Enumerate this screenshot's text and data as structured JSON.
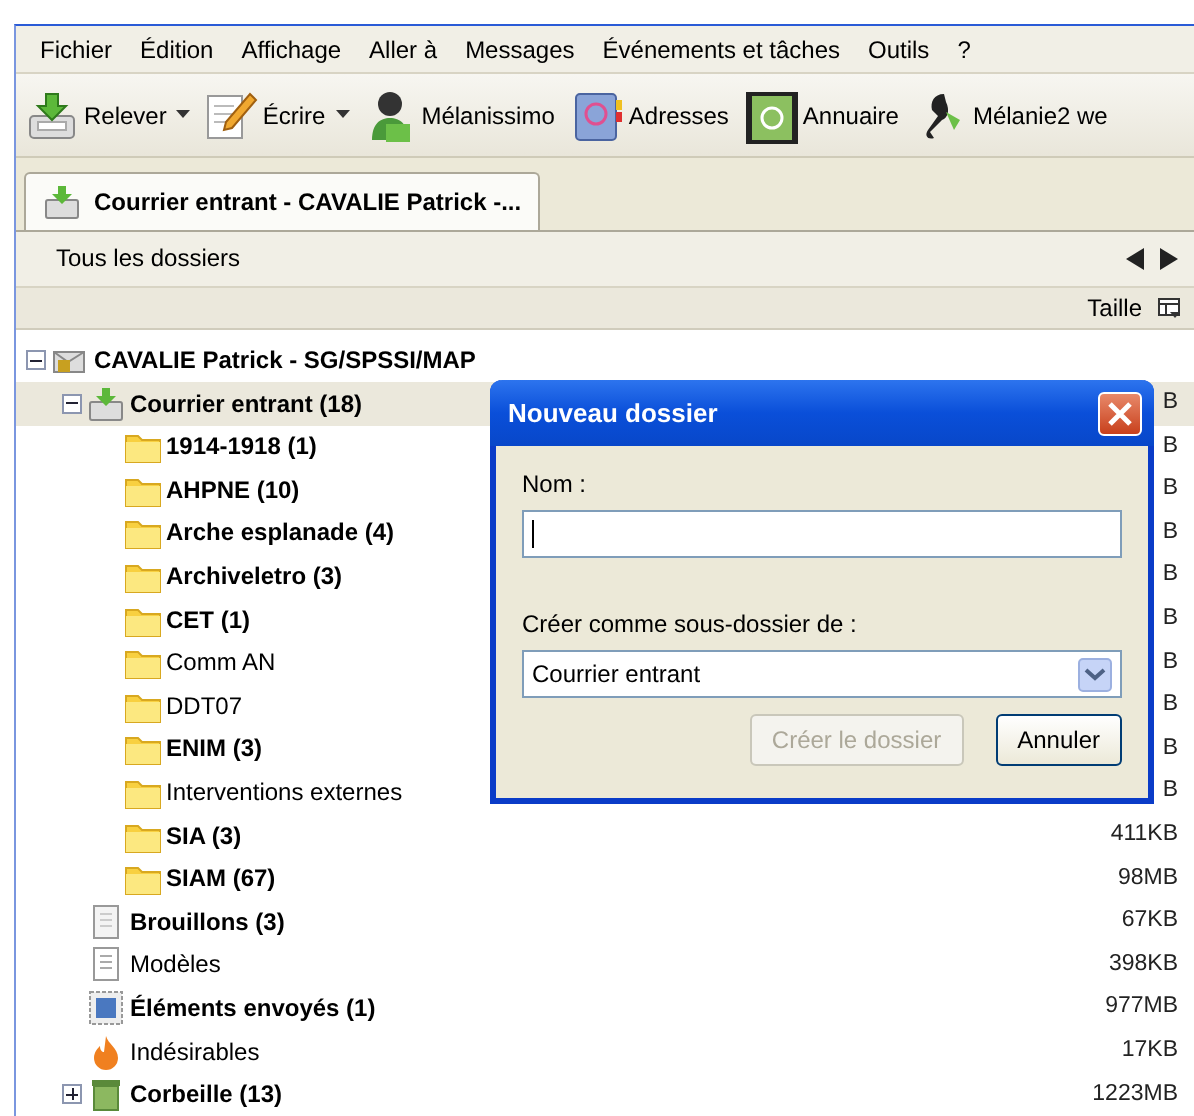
{
  "menu": [
    "Fichier",
    "Édition",
    "Affichage",
    "Aller à",
    "Messages",
    "Événements et tâches",
    "Outils",
    "?"
  ],
  "toolbar": [
    {
      "label": "Relever",
      "kind": "get",
      "dropdown": true
    },
    {
      "label": "Écrire",
      "kind": "write",
      "dropdown": true
    },
    {
      "label": "Mélanissimo",
      "kind": "person",
      "dropdown": false
    },
    {
      "label": "Adresses",
      "kind": "book",
      "dropdown": false
    },
    {
      "label": "Annuaire",
      "kind": "directory",
      "dropdown": false
    },
    {
      "label": "Mélanie2 we",
      "kind": "figure",
      "dropdown": false
    }
  ],
  "tabs": [
    {
      "label": "Courrier entrant - CAVALIE Patrick -...",
      "selected": true
    }
  ],
  "folder_pane": {
    "title": "Tous les dossiers",
    "column": "Taille"
  },
  "tree": [
    {
      "label": "CAVALIE Patrick - SG/SPSSI/MAP",
      "kind": "account",
      "unread": true,
      "selected": false,
      "expanded": true,
      "children": [
        {
          "label": "Courrier entrant (18)",
          "kind": "inbox",
          "unread": true,
          "selected": true,
          "expanded": true,
          "size": "B",
          "children": [
            {
              "label": "1914-1918 (1)",
              "kind": "folder",
              "unread": true,
              "selected": false,
              "size": "B"
            },
            {
              "label": "AHPNE (10)",
              "kind": "folder",
              "unread": true,
              "selected": false,
              "size": "B"
            },
            {
              "label": "Arche esplanade (4)",
              "kind": "folder",
              "unread": true,
              "selected": false,
              "size": "B"
            },
            {
              "label": "Archiveletro (3)",
              "kind": "folder",
              "unread": true,
              "selected": false,
              "size": "B"
            },
            {
              "label": "CET (1)",
              "kind": "folder",
              "unread": true,
              "selected": false,
              "size": "B"
            },
            {
              "label": "Comm AN",
              "kind": "folder",
              "unread": false,
              "selected": false,
              "size": "B"
            },
            {
              "label": "DDT07",
              "kind": "folder",
              "unread": false,
              "selected": false,
              "size": "B"
            },
            {
              "label": "ENIM (3)",
              "kind": "folder",
              "unread": true,
              "selected": false,
              "size": "B"
            },
            {
              "label": "Interventions externes",
              "kind": "folder",
              "unread": false,
              "selected": false,
              "size": "B"
            },
            {
              "label": "SIA (3)",
              "kind": "folder",
              "unread": true,
              "selected": false,
              "size": "411KB"
            },
            {
              "label": "SIAM (67)",
              "kind": "folder",
              "unread": true,
              "selected": false,
              "size": "98MB"
            }
          ]
        },
        {
          "label": "Brouillons (3)",
          "kind": "drafts",
          "unread": true,
          "selected": false,
          "size": "67KB"
        },
        {
          "label": "Modèles",
          "kind": "templates",
          "unread": false,
          "selected": false,
          "size": "398KB"
        },
        {
          "label": "Éléments envoyés (1)",
          "kind": "sent",
          "unread": true,
          "selected": false,
          "size": "977MB"
        },
        {
          "label": "Indésirables",
          "kind": "junk",
          "unread": false,
          "selected": false,
          "size": "17KB"
        },
        {
          "label": "Corbeille (13)",
          "kind": "trash",
          "unread": true,
          "selected": false,
          "expanded": false,
          "size": "1223MB"
        }
      ]
    }
  ],
  "dialog": {
    "title": "Nouveau dossier",
    "name_label": "Nom :",
    "parent_label": "Créer comme sous-dossier de :",
    "parent_value": "Courrier entrant",
    "buttons": [
      {
        "label": "Créer le dossier",
        "disabled": true
      },
      {
        "label": "Annuler",
        "disabled": false
      }
    ]
  }
}
